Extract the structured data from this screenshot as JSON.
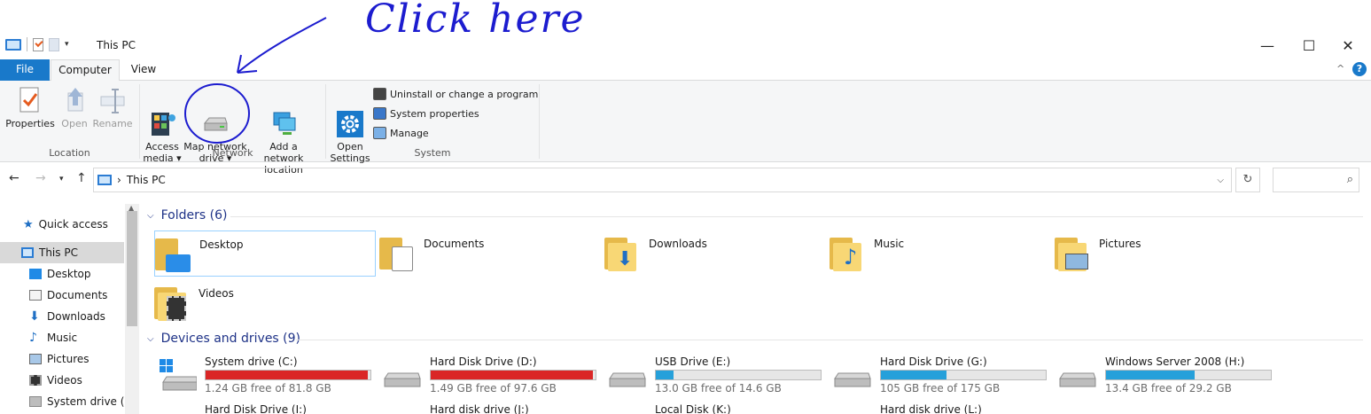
{
  "annotation": {
    "text": "Click here"
  },
  "window": {
    "title": "This PC",
    "minimize": "—",
    "maximize": "☐",
    "close": "✕"
  },
  "ribbon_tabs": [
    {
      "label": "File"
    },
    {
      "label": "Computer"
    },
    {
      "label": "View"
    }
  ],
  "ribbon": {
    "location": {
      "label": "Location",
      "buttons": [
        {
          "label": "Properties",
          "icon": "properties-icon"
        },
        {
          "label": "Open",
          "icon": "open-icon"
        },
        {
          "label": "Rename",
          "icon": "rename-icon"
        }
      ]
    },
    "network": {
      "label": "Network",
      "buttons": [
        {
          "label": "Access\nmedia ▾",
          "icon": "media-icon"
        },
        {
          "label": "Map network\ndrive ▾",
          "icon": "network-drive-icon"
        },
        {
          "label": "Add a network\nlocation",
          "icon": "network-location-icon"
        }
      ]
    },
    "system": {
      "label": "System",
      "open_settings": "Open\nSettings",
      "small_buttons": [
        {
          "label": "Uninstall or change a program",
          "icon": "uninstall-icon"
        },
        {
          "label": "System properties",
          "icon": "system-properties-icon"
        },
        {
          "label": "Manage",
          "icon": "manage-icon"
        }
      ]
    }
  },
  "address": {
    "path": "This PC",
    "separator": "›"
  },
  "sidebar": {
    "items": [
      {
        "label": "Quick access",
        "icon": "star-icon"
      },
      {
        "label": "This PC",
        "icon": "pc-icon",
        "selected": true
      },
      {
        "label": "Desktop",
        "icon": "desktop-icon"
      },
      {
        "label": "Documents",
        "icon": "documents-icon"
      },
      {
        "label": "Downloads",
        "icon": "downloads-icon"
      },
      {
        "label": "Music",
        "icon": "music-icon"
      },
      {
        "label": "Pictures",
        "icon": "pictures-icon"
      },
      {
        "label": "Videos",
        "icon": "videos-icon"
      },
      {
        "label": "System drive (C:",
        "icon": "drive-icon"
      }
    ]
  },
  "folders": {
    "header": "Folders (6)",
    "items": [
      {
        "name": "Desktop"
      },
      {
        "name": "Documents"
      },
      {
        "name": "Downloads"
      },
      {
        "name": "Music"
      },
      {
        "name": "Pictures"
      },
      {
        "name": "Videos"
      }
    ]
  },
  "drives": {
    "header": "Devices and drives (9)",
    "items": [
      {
        "name": "System drive (C:)",
        "free": "1.24 GB free of 81.8 GB",
        "used_fraction": 0.985,
        "color": "#da2626"
      },
      {
        "name": "Hard Disk Drive  (D:)",
        "free": "1.49 GB free of 97.6 GB",
        "used_fraction": 0.985,
        "color": "#da2626"
      },
      {
        "name": "USB Drive (E:)",
        "free": "13.0 GB free of 14.6 GB",
        "used_fraction": 0.11,
        "color": "#26a0da"
      },
      {
        "name": "Hard Disk Drive (G:)",
        "free": "105 GB free of 175 GB",
        "used_fraction": 0.4,
        "color": "#26a0da"
      },
      {
        "name": "Windows Server 2008 (H:)",
        "free": "13.4 GB free of 29.2 GB",
        "used_fraction": 0.54,
        "color": "#26a0da"
      },
      {
        "name": "Hard Disk Drive (I:)"
      },
      {
        "name": "Hard disk drive (J:)"
      },
      {
        "name": "Local Disk (K:)"
      },
      {
        "name": "Hard disk drive (L:)"
      }
    ]
  }
}
